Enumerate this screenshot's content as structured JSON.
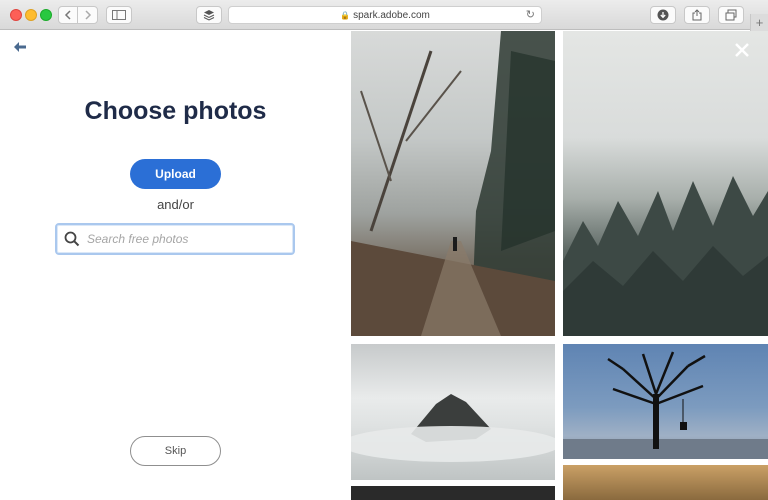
{
  "browser": {
    "url": "spark.adobe.com",
    "new_tab_label": "+"
  },
  "modal": {
    "title": "Choose photos",
    "upload_label": "Upload",
    "separator": "and/or",
    "search_placeholder": "Search free photos",
    "skip_label": "Skip"
  },
  "icons": {
    "back": "back-arrow-icon",
    "close": "close-icon",
    "search": "search-icon"
  },
  "colors": {
    "accent": "#2b6fd6",
    "title": "#1f2b48",
    "search_border": "#aac8ee"
  }
}
